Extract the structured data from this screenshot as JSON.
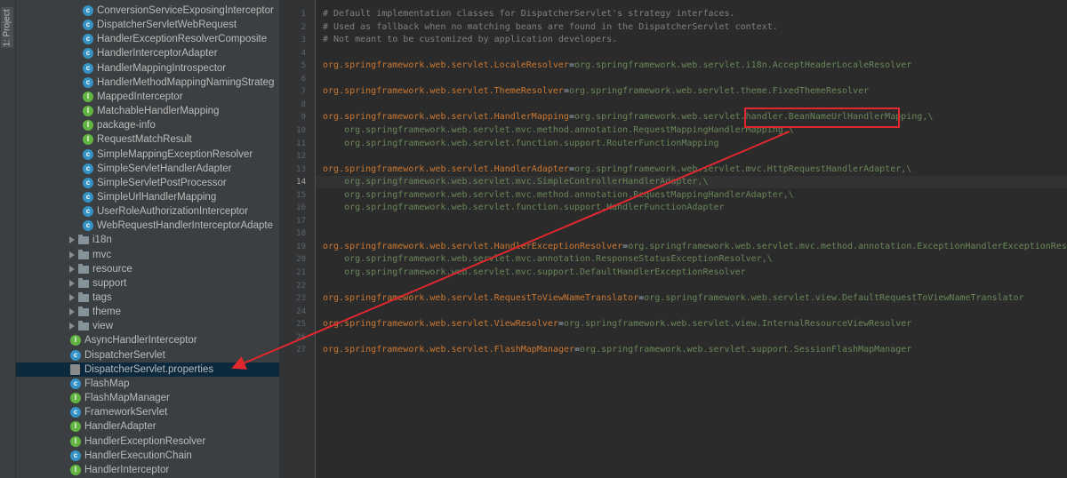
{
  "sidebar_tab": "1: Project",
  "tree": [
    {
      "label": "ConversionServiceExposingInterceptor",
      "indent": 2,
      "type": "class"
    },
    {
      "label": "DispatcherServletWebRequest",
      "indent": 2,
      "type": "class"
    },
    {
      "label": "HandlerExceptionResolverComposite",
      "indent": 2,
      "type": "class"
    },
    {
      "label": "HandlerInterceptorAdapter",
      "indent": 2,
      "type": "class"
    },
    {
      "label": "HandlerMappingIntrospector",
      "indent": 2,
      "type": "class"
    },
    {
      "label": "HandlerMethodMappingNamingStrateg",
      "indent": 2,
      "type": "class"
    },
    {
      "label": "MappedInterceptor",
      "indent": 2,
      "type": "iface"
    },
    {
      "label": "MatchableHandlerMapping",
      "indent": 2,
      "type": "iface"
    },
    {
      "label": "package-info",
      "indent": 2,
      "type": "iface"
    },
    {
      "label": "RequestMatchResult",
      "indent": 2,
      "type": "iface"
    },
    {
      "label": "SimpleMappingExceptionResolver",
      "indent": 2,
      "type": "class"
    },
    {
      "label": "SimpleServletHandlerAdapter",
      "indent": 2,
      "type": "class"
    },
    {
      "label": "SimpleServletPostProcessor",
      "indent": 2,
      "type": "class"
    },
    {
      "label": "SimpleUrlHandlerMapping",
      "indent": 2,
      "type": "class"
    },
    {
      "label": "UserRoleAuthorizationInterceptor",
      "indent": 2,
      "type": "class"
    },
    {
      "label": "WebRequestHandlerInterceptorAdapte",
      "indent": 2,
      "type": "class"
    },
    {
      "label": "i18n",
      "indent": 1,
      "type": "folder"
    },
    {
      "label": "mvc",
      "indent": 1,
      "type": "folder"
    },
    {
      "label": "resource",
      "indent": 1,
      "type": "folder"
    },
    {
      "label": "support",
      "indent": 1,
      "type": "folder"
    },
    {
      "label": "tags",
      "indent": 1,
      "type": "folder"
    },
    {
      "label": "theme",
      "indent": 1,
      "type": "folder"
    },
    {
      "label": "view",
      "indent": 1,
      "type": "folder"
    },
    {
      "label": "AsyncHandlerInterceptor",
      "indent": 1,
      "type": "iface"
    },
    {
      "label": "DispatcherServlet",
      "indent": 1,
      "type": "class"
    },
    {
      "label": "DispatcherServlet.properties",
      "indent": 1,
      "type": "props",
      "selected": true
    },
    {
      "label": "FlashMap",
      "indent": 1,
      "type": "class"
    },
    {
      "label": "FlashMapManager",
      "indent": 1,
      "type": "iface"
    },
    {
      "label": "FrameworkServlet",
      "indent": 1,
      "type": "class"
    },
    {
      "label": "HandlerAdapter",
      "indent": 1,
      "type": "iface"
    },
    {
      "label": "HandlerExceptionResolver",
      "indent": 1,
      "type": "iface"
    },
    {
      "label": "HandlerExecutionChain",
      "indent": 1,
      "type": "class"
    },
    {
      "label": "HandlerInterceptor",
      "indent": 1,
      "type": "iface"
    }
  ],
  "line_numbers": [
    "1",
    "2",
    "3",
    "4",
    "5",
    "6",
    "7",
    "8",
    "9",
    "10",
    "11",
    "12",
    "13",
    "14",
    "15",
    "16",
    "17",
    "18",
    "19",
    "20",
    "21",
    "22",
    "23",
    "24",
    "25",
    "26",
    "27"
  ],
  "current_line": "14",
  "code": [
    [
      {
        "t": "# Default implementation classes for DispatcherServlet's strategy interfaces.",
        "s": "c"
      }
    ],
    [
      {
        "t": "# Used as fallback when no matching beans are found in the DispatcherServlet context.",
        "s": "c"
      }
    ],
    [
      {
        "t": "# Not meant to be customized by application developers.",
        "s": "c"
      }
    ],
    [],
    [
      {
        "t": "org.springframework.web.servlet.LocaleResolver",
        "s": "k"
      },
      {
        "t": "=",
        "s": "p"
      },
      {
        "t": "org.springframework.web.servlet.i18n.AcceptHeaderLocaleResolver",
        "s": "v"
      }
    ],
    [],
    [
      {
        "t": "org.springframework.web.servlet.ThemeResolver",
        "s": "k"
      },
      {
        "t": "=",
        "s": "p"
      },
      {
        "t": "org.springframework.web.servlet.theme.FixedThemeResolver",
        "s": "v"
      }
    ],
    [],
    [
      {
        "t": "org.springframework.web.servlet.HandlerMapping",
        "s": "k"
      },
      {
        "t": "=",
        "s": "p"
      },
      {
        "t": "org.springframework.web.servlet.handler.BeanNameUrlHandlerMapping,\\",
        "s": "v"
      }
    ],
    [
      {
        "t": "    org.springframework.web.servlet.mvc.method.annotation.RequestMappingHandlerMapping,\\",
        "s": "v"
      }
    ],
    [
      {
        "t": "    org.springframework.web.servlet.function.support.RouterFunctionMapping",
        "s": "v"
      }
    ],
    [],
    [
      {
        "t": "org.springframework.web.servlet.HandlerAdapter",
        "s": "k"
      },
      {
        "t": "=",
        "s": "p"
      },
      {
        "t": "org.springframework.web.servlet.mvc.HttpRequestHandlerAdapter,\\",
        "s": "v"
      }
    ],
    [
      {
        "t": "    org.springframework.web.servlet.mvc.SimpleControllerHandlerAdapter,\\",
        "s": "v"
      }
    ],
    [
      {
        "t": "    org.springframework.web.servlet.mvc.method.annotation.RequestMappingHandlerAdapter,\\",
        "s": "v"
      }
    ],
    [
      {
        "t": "    org.springframework.web.servlet.function.support.HandlerFunctionAdapter",
        "s": "v"
      }
    ],
    [],
    [],
    [
      {
        "t": "org.springframework.web.servlet.HandlerExceptionResolver",
        "s": "k"
      },
      {
        "t": "=",
        "s": "p"
      },
      {
        "t": "org.springframework.web.servlet.mvc.method.annotation.ExceptionHandlerExceptionResolver,\\",
        "s": "v"
      }
    ],
    [
      {
        "t": "    org.springframework.web.servlet.mvc.annotation.ResponseStatusExceptionResolver,\\",
        "s": "v"
      }
    ],
    [
      {
        "t": "    org.springframework.web.servlet.mvc.support.DefaultHandlerExceptionResolver",
        "s": "v"
      }
    ],
    [],
    [
      {
        "t": "org.springframework.web.servlet.RequestToViewNameTranslator",
        "s": "k"
      },
      {
        "t": "=",
        "s": "p"
      },
      {
        "t": "org.springframework.web.servlet.view.DefaultRequestToViewNameTranslator",
        "s": "v"
      }
    ],
    [],
    [
      {
        "t": "org.springframework.web.servlet.ViewResolver",
        "s": "k"
      },
      {
        "t": "=",
        "s": "p"
      },
      {
        "t": "org.springframework.web.servlet.view.InternalResourceViewResolver",
        "s": "v"
      }
    ],
    [],
    [
      {
        "t": "org.springframework.web.servlet.FlashMapManager",
        "s": "k"
      },
      {
        "t": "=",
        "s": "p"
      },
      {
        "t": "org.springframework.web.servlet.support.SessionFlashMapManager",
        "s": "v"
      }
    ]
  ],
  "colors": {
    "annotation": "#e0282e",
    "selection": "#0d293e",
    "keyword": "#cc7832",
    "value": "#6a8759",
    "comment": "#808080"
  },
  "icons": {
    "class": "class-icon",
    "iface": "interface-icon",
    "folder": "folder-icon",
    "props": "properties-file-icon",
    "arrow": "expand-arrow-icon"
  }
}
